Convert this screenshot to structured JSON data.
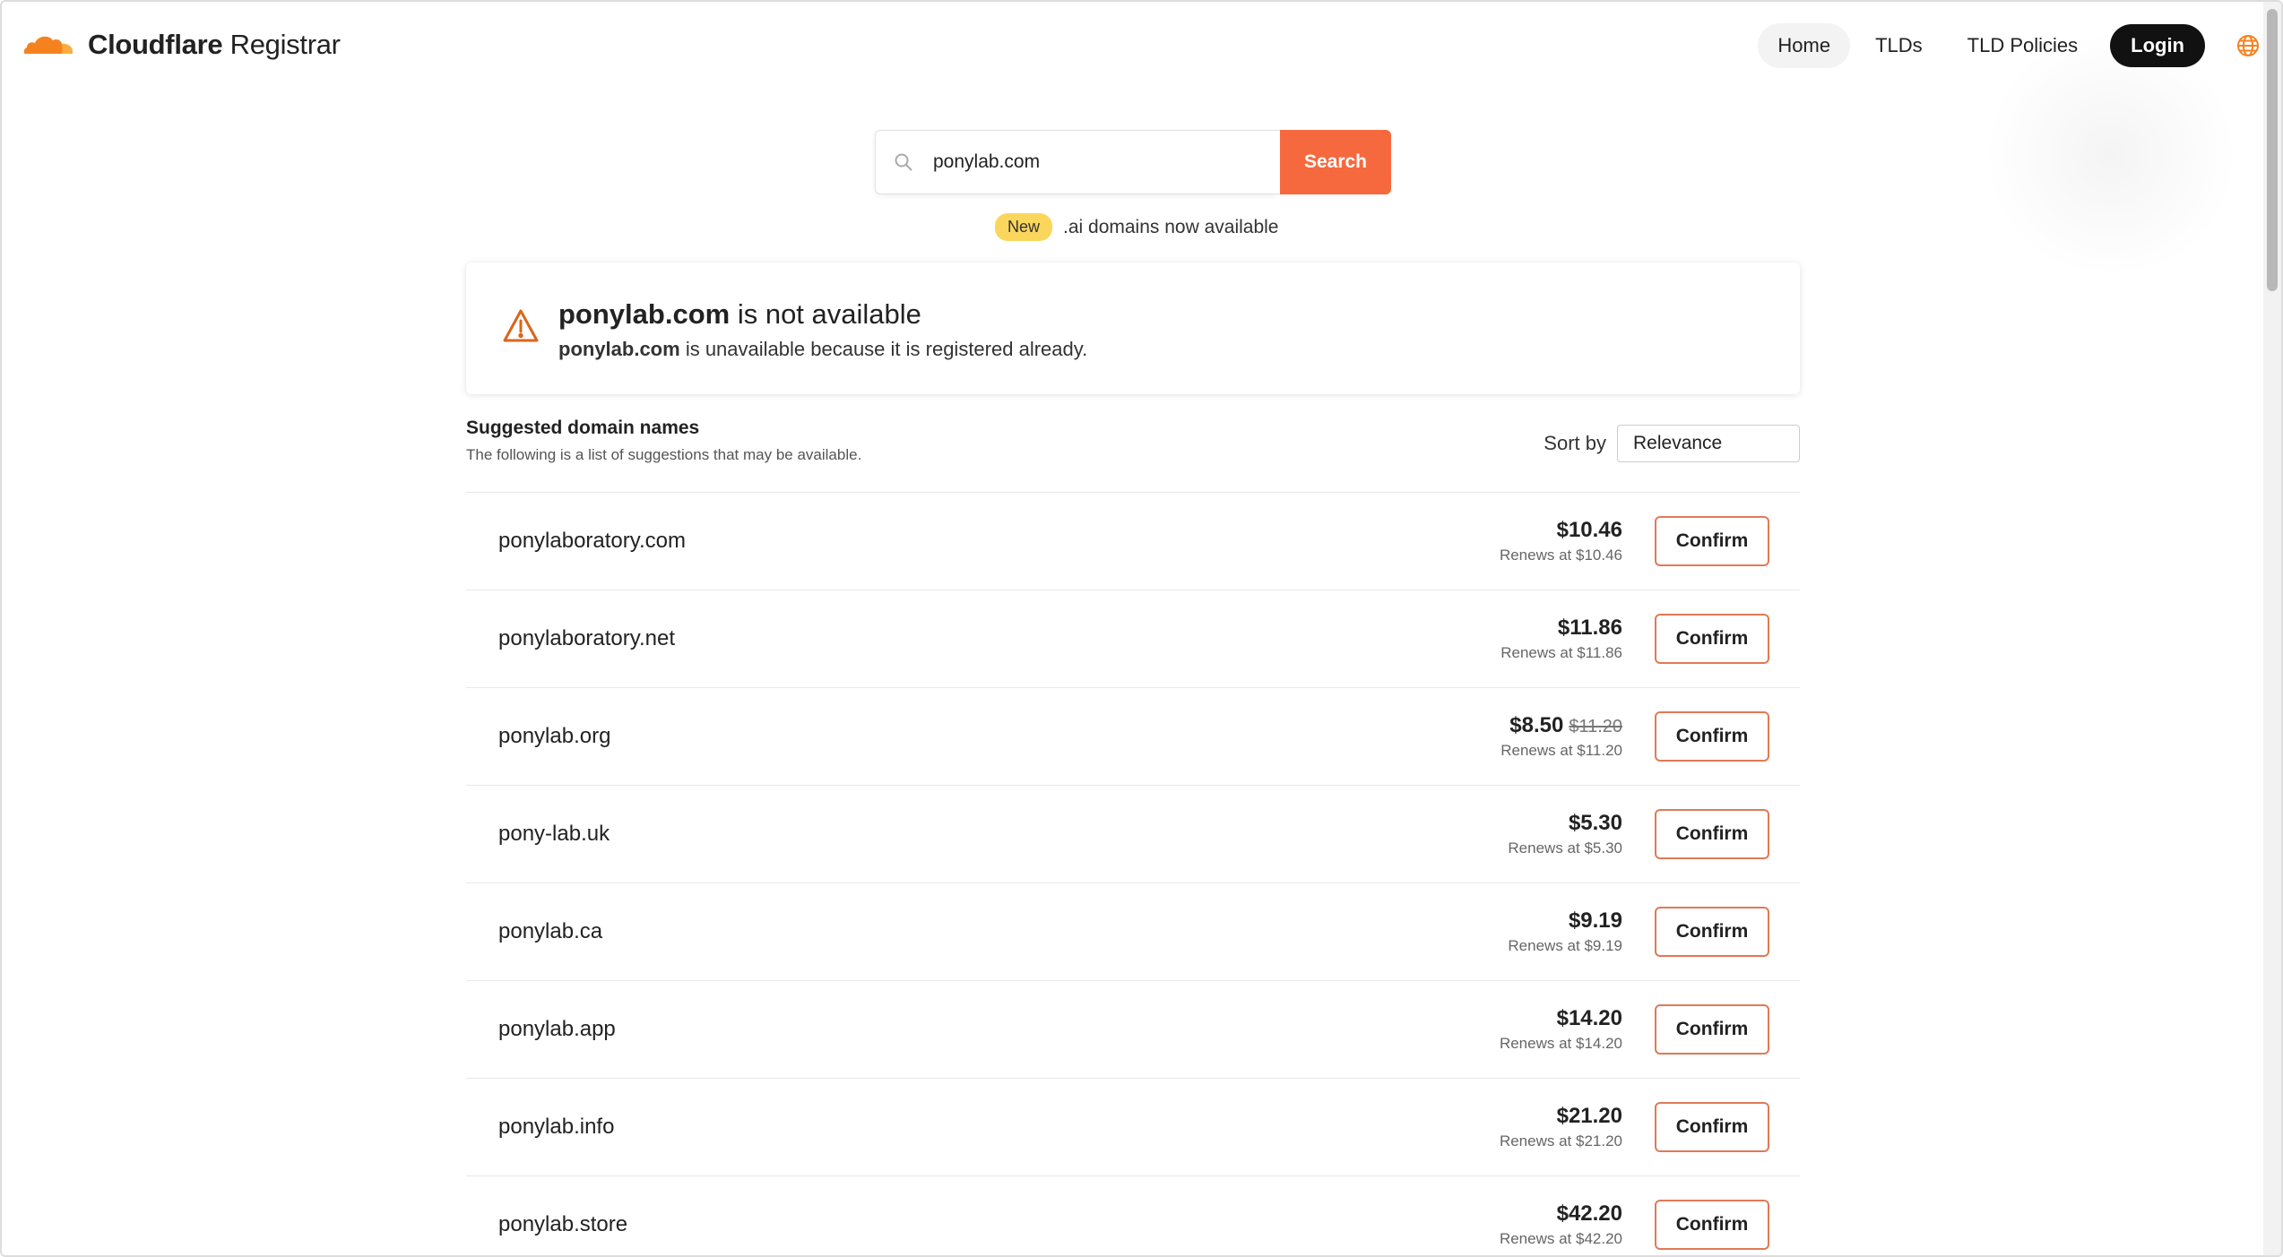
{
  "header": {
    "brand_strong": "Cloudflare",
    "brand_light": "Registrar",
    "nav": [
      {
        "label": "Home"
      },
      {
        "label": "TLDs"
      },
      {
        "label": "TLD Policies"
      }
    ],
    "login_label": "Login",
    "brand_color": "#f6821f"
  },
  "search": {
    "value": "ponylab.com",
    "button_label": "Search",
    "accent": "#f6693e"
  },
  "announcement": {
    "badge": "New",
    "text": ".ai domains now available"
  },
  "alert": {
    "domain": "ponylab.com",
    "title_suffix": "is not available",
    "desc_domain": "ponylab.com",
    "desc_suffix": "is unavailable because it is registered already."
  },
  "suggestions": {
    "title": "Suggested domain names",
    "subtitle": "The following is a list of suggestions that may be available.",
    "sort_label": "Sort by",
    "sort_value": "Relevance",
    "confirm_label": "Confirm",
    "items": [
      {
        "domain": "ponylaboratory.com",
        "price": "$10.46",
        "old_price": "",
        "renew": "Renews at $10.46"
      },
      {
        "domain": "ponylaboratory.net",
        "price": "$11.86",
        "old_price": "",
        "renew": "Renews at $11.86"
      },
      {
        "domain": "ponylab.org",
        "price": "$8.50",
        "old_price": "$11.20",
        "renew": "Renews at $11.20"
      },
      {
        "domain": "pony-lab.uk",
        "price": "$5.30",
        "old_price": "",
        "renew": "Renews at $5.30"
      },
      {
        "domain": "ponylab.ca",
        "price": "$9.19",
        "old_price": "",
        "renew": "Renews at $9.19"
      },
      {
        "domain": "ponylab.app",
        "price": "$14.20",
        "old_price": "",
        "renew": "Renews at $14.20"
      },
      {
        "domain": "ponylab.info",
        "price": "$21.20",
        "old_price": "",
        "renew": "Renews at $21.20"
      },
      {
        "domain": "ponylab.store",
        "price": "$42.20",
        "old_price": "",
        "renew": "Renews at $42.20"
      }
    ]
  }
}
